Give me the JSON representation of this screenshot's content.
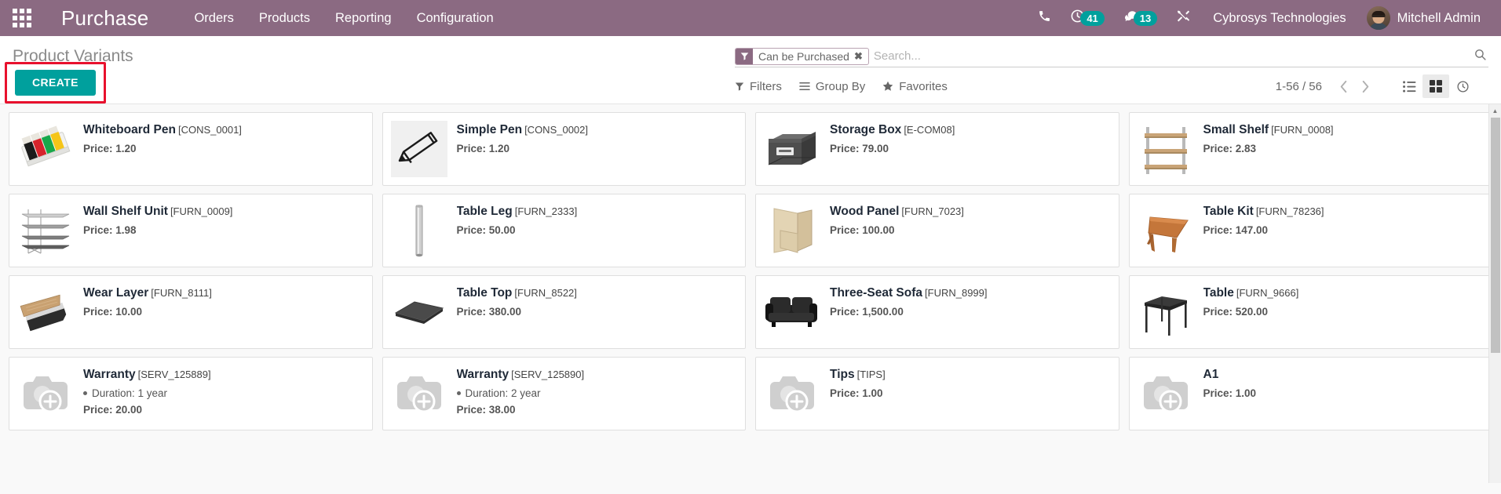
{
  "navbar": {
    "apps_icon": "apps-grid-icon",
    "brand": "Purchase",
    "menu": [
      {
        "label": "Orders"
      },
      {
        "label": "Products"
      },
      {
        "label": "Reporting"
      },
      {
        "label": "Configuration"
      }
    ],
    "phone_icon": "phone-icon",
    "activity": {
      "icon": "clock-icon",
      "count": "41"
    },
    "messages": {
      "icon": "chat-bubble-icon",
      "count": "13"
    },
    "debug_icon": "wrench-screwdriver-icon",
    "company": "Cybrosys Technologies",
    "user": "Mitchell Admin",
    "avatar": "user-avatar"
  },
  "control_panel": {
    "title": "Product Variants",
    "create_label": "CREATE",
    "search": {
      "placeholder": "Search...",
      "value": "",
      "search_icon": "magnifier-icon",
      "facet": {
        "icon": "filter-funnel-icon",
        "label": "Can be Purchased",
        "remove_icon": "close-x-icon"
      }
    },
    "menus": [
      {
        "label": "Filters",
        "icon": "filter-funnel-icon"
      },
      {
        "label": "Group By",
        "icon": "hamburger-lines-icon"
      },
      {
        "label": "Favorites",
        "icon": "star-icon"
      }
    ],
    "pager": {
      "value": "1-56 / 56",
      "prev_icon": "chevron-left-icon",
      "next_icon": "chevron-right-icon"
    },
    "views": [
      {
        "name": "list",
        "icon": "list-view-icon",
        "active": false
      },
      {
        "name": "kanban",
        "icon": "kanban-view-icon",
        "active": true
      },
      {
        "name": "activity",
        "icon": "activity-clock-icon",
        "active": false
      }
    ]
  },
  "colors": {
    "navbar_bg": "#8B6A82",
    "accent_teal": "#00A09D",
    "highlight_red": "#e8112d",
    "page_bg": "#f9f9f9"
  },
  "products": [
    {
      "name": "Whiteboard Pen",
      "code": "[CONS_0001]",
      "price_label": "Price: 1.20",
      "image": "whiteboard-pen-image"
    },
    {
      "name": "Simple Pen",
      "code": "[CONS_0002]",
      "price_label": "Price: 1.20",
      "image": "simple-pen-image"
    },
    {
      "name": "Storage Box",
      "code": "[E-COM08]",
      "price_label": "Price: 79.00",
      "image": "storage-box-image"
    },
    {
      "name": "Small Shelf",
      "code": "[FURN_0008]",
      "price_label": "Price: 2.83",
      "image": "small-shelf-image"
    },
    {
      "name": "Wall Shelf Unit",
      "code": "[FURN_0009]",
      "price_label": "Price: 1.98",
      "image": "wall-shelf-unit-image"
    },
    {
      "name": "Table Leg",
      "code": "[FURN_2333]",
      "price_label": "Price: 50.00",
      "image": "table-leg-image"
    },
    {
      "name": "Wood Panel",
      "code": "[FURN_7023]",
      "price_label": "Price: 100.00",
      "image": "wood-panel-image"
    },
    {
      "name": "Table Kit",
      "code": "[FURN_78236]",
      "price_label": "Price: 147.00",
      "image": "table-kit-image"
    },
    {
      "name": "Wear Layer",
      "code": "[FURN_8111]",
      "price_label": "Price: 10.00",
      "image": "wear-layer-image"
    },
    {
      "name": "Table Top",
      "code": "[FURN_8522]",
      "price_label": "Price: 380.00",
      "image": "table-top-image"
    },
    {
      "name": "Three-Seat Sofa",
      "code": "[FURN_8999]",
      "price_label": "Price: 1,500.00",
      "image": "three-seat-sofa-image"
    },
    {
      "name": "Table",
      "code": "[FURN_9666]",
      "price_label": "Price: 520.00",
      "image": "table-image"
    },
    {
      "name": "Warranty",
      "code": "[SERV_125889]",
      "variant": "Duration: 1 year",
      "price_label": "Price: 20.00",
      "image": "placeholder-camera-image"
    },
    {
      "name": "Warranty",
      "code": "[SERV_125890]",
      "variant": "Duration: 2 year",
      "price_label": "Price: 38.00",
      "image": "placeholder-camera-image"
    },
    {
      "name": "Tips",
      "code": "[TIPS]",
      "price_label": "Price: 1.00",
      "image": "placeholder-camera-image"
    },
    {
      "name": "A1",
      "code": "",
      "price_label": "Price: 1.00",
      "image": "placeholder-camera-image"
    }
  ]
}
